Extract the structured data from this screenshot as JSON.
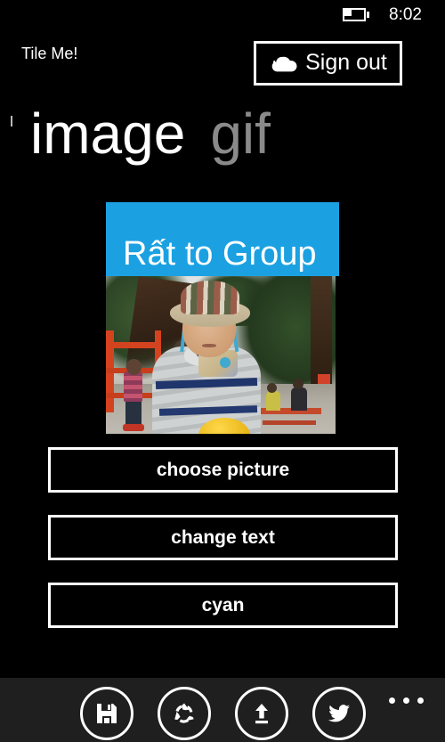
{
  "status_bar": {
    "battery_icon": "battery-icon",
    "battery_level_percent": 35,
    "time": "8:02"
  },
  "header": {
    "app_title": "Tile Me!",
    "sign_out": {
      "label": "Sign out",
      "icon": "cloud-icon"
    }
  },
  "pivot": {
    "items": [
      {
        "label": "image",
        "state": "active"
      },
      {
        "label": "gif",
        "state": "inactive"
      }
    ]
  },
  "tile_preview": {
    "title": "Rất to Group",
    "accent_color": "#1ba1e2",
    "photo_alt": "child in bucket hat at playground"
  },
  "actions": {
    "buttons": [
      {
        "label": "choose picture",
        "name": "choose-picture-button"
      },
      {
        "label": "change text",
        "name": "change-text-button"
      },
      {
        "label": "cyan",
        "name": "tile-color-button"
      }
    ]
  },
  "app_bar": {
    "background_color": "#1f1f1f",
    "buttons": [
      {
        "name": "save-button",
        "icon": "save-icon"
      },
      {
        "name": "reset-button",
        "icon": "recycle-icon"
      },
      {
        "name": "upload-button",
        "icon": "upload-icon"
      },
      {
        "name": "twitter-button",
        "icon": "twitter-icon"
      }
    ],
    "more_label": "..."
  }
}
